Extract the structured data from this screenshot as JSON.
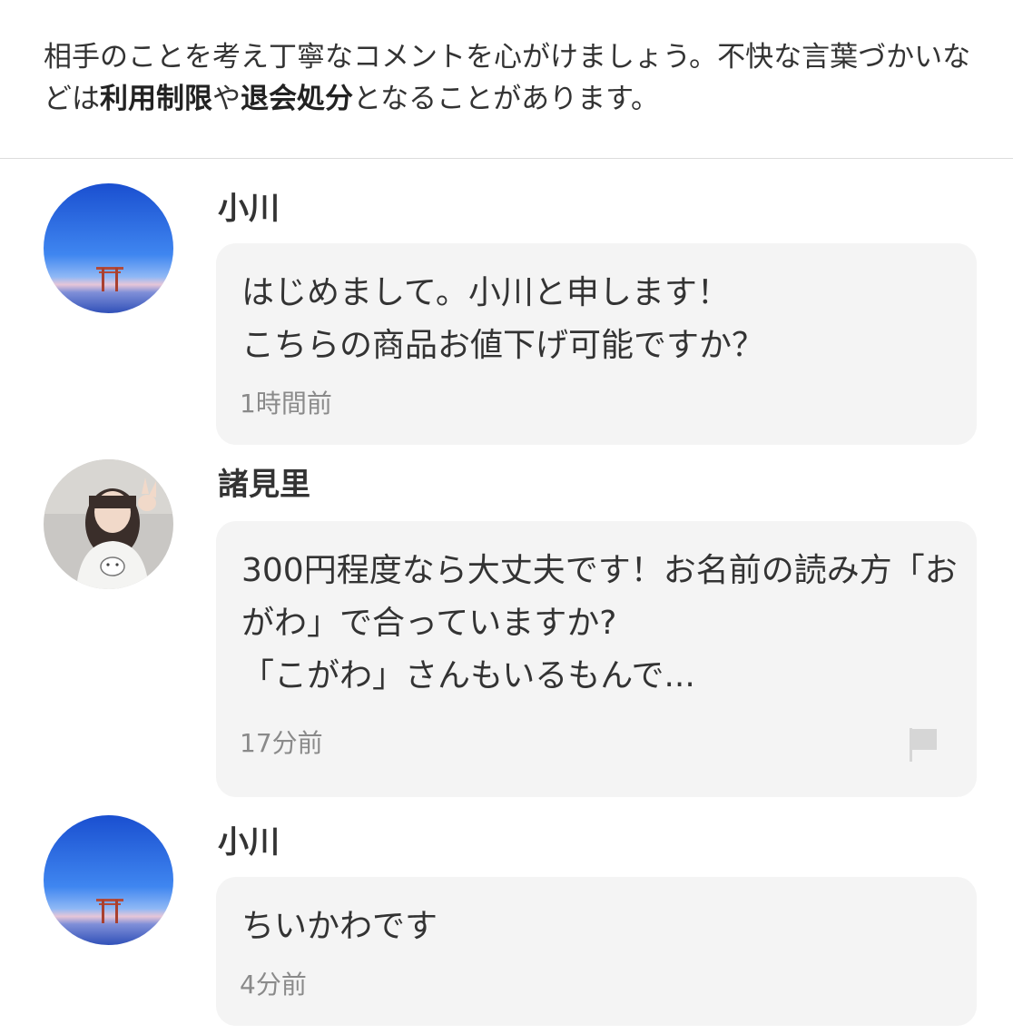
{
  "notice": {
    "text_1": "相手のことを考え丁寧なコメントを心がけましょう。不快な言葉づかいなどは",
    "bold_1": "利用制限",
    "text_2": "や",
    "bold_2": "退会処分",
    "text_3": "となることがあります。"
  },
  "comments": [
    {
      "user": "小川",
      "message": "はじめまして。小川と申します！\nこちらの商品お値下げ可能ですか？",
      "time": "1時間前"
    },
    {
      "user": "諸見里",
      "message": "300円程度なら大丈夫です！お名前の読み方「おがわ」で合っていますか?\n「こがわ」さんもいるもんで...",
      "time": "17分前"
    },
    {
      "user": "小川",
      "message": "ちいかわです",
      "time": "4分前"
    }
  ],
  "icons": {
    "report": "flag-icon"
  },
  "colors": {
    "bubble_bg": "#f4f4f4",
    "time_text": "#8a8a8a",
    "divider": "#dcdcdc"
  }
}
